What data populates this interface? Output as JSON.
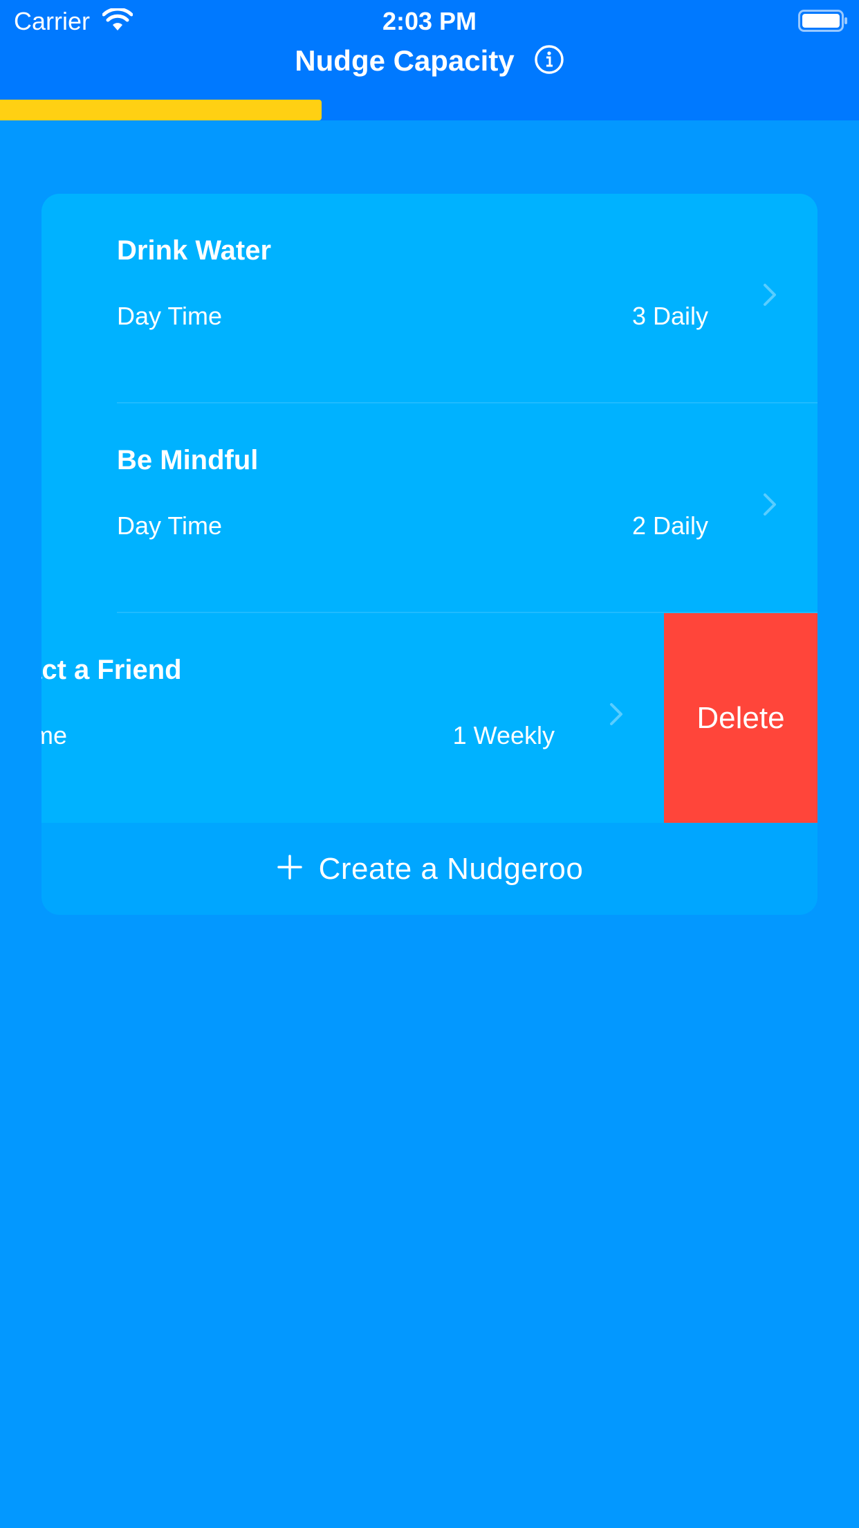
{
  "status_bar": {
    "carrier": "Carrier",
    "time": "2:03 PM"
  },
  "nav": {
    "title": "Nudge Capacity"
  },
  "capacity": {
    "fill_fraction": 0.374,
    "color": "#ffd013"
  },
  "nudges": [
    {
      "title": "Drink Water",
      "time": "Day Time",
      "frequency": "3 Daily"
    },
    {
      "title": "Be Mindful",
      "time": "Day Time",
      "frequency": "2 Daily"
    },
    {
      "title": "Contact a Friend",
      "time": "Any Time",
      "frequency": "1 Weekly"
    }
  ],
  "swipe_action": {
    "label": "Delete",
    "color": "#ff453a"
  },
  "create": {
    "label": "Create a Nudgeroo"
  },
  "colors": {
    "background": "#0398ff",
    "nav_bar": "#0079ff",
    "card": "#00a6ff",
    "row": "#00b2ff"
  }
}
